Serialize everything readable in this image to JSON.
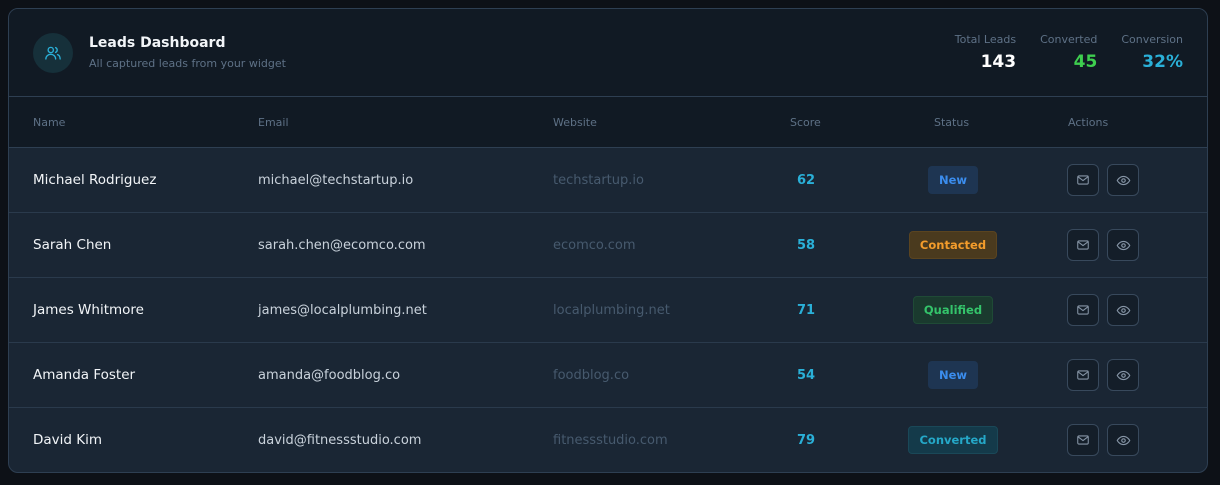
{
  "header": {
    "title": "Leads Dashboard",
    "subtitle": "All captured leads from your widget",
    "icon": "users-icon"
  },
  "stats": [
    {
      "label": "Total Leads",
      "value": "143",
      "color": "#ffffff"
    },
    {
      "label": "Converted",
      "value": "45",
      "color": "#3ecf4f"
    },
    {
      "label": "Conversion",
      "value": "32%",
      "color": "#2ab0d8"
    }
  ],
  "columns": {
    "name": "Name",
    "email": "Email",
    "website": "Website",
    "score": "Score",
    "status": "Status",
    "actions": "Actions"
  },
  "rows": [
    {
      "name": "Michael Rodriguez",
      "email": "michael@techstartup.io",
      "website": "techstartup.io",
      "score": "62",
      "status": "New",
      "status_kind": "new"
    },
    {
      "name": "Sarah Chen",
      "email": "sarah.chen@ecomco.com",
      "website": "ecomco.com",
      "score": "58",
      "status": "Contacted",
      "status_kind": "contacted"
    },
    {
      "name": "James Whitmore",
      "email": "james@localplumbing.net",
      "website": "localplumbing.net",
      "score": "71",
      "status": "Qualified",
      "status_kind": "qualified"
    },
    {
      "name": "Amanda Foster",
      "email": "amanda@foodblog.co",
      "website": "foodblog.co",
      "score": "54",
      "status": "New",
      "status_kind": "new"
    },
    {
      "name": "David Kim",
      "email": "david@fitnessstudio.com",
      "website": "fitnessstudio.com",
      "score": "79",
      "status": "Converted",
      "status_kind": "converted"
    }
  ],
  "actions": [
    "mail-icon",
    "eye-icon"
  ]
}
